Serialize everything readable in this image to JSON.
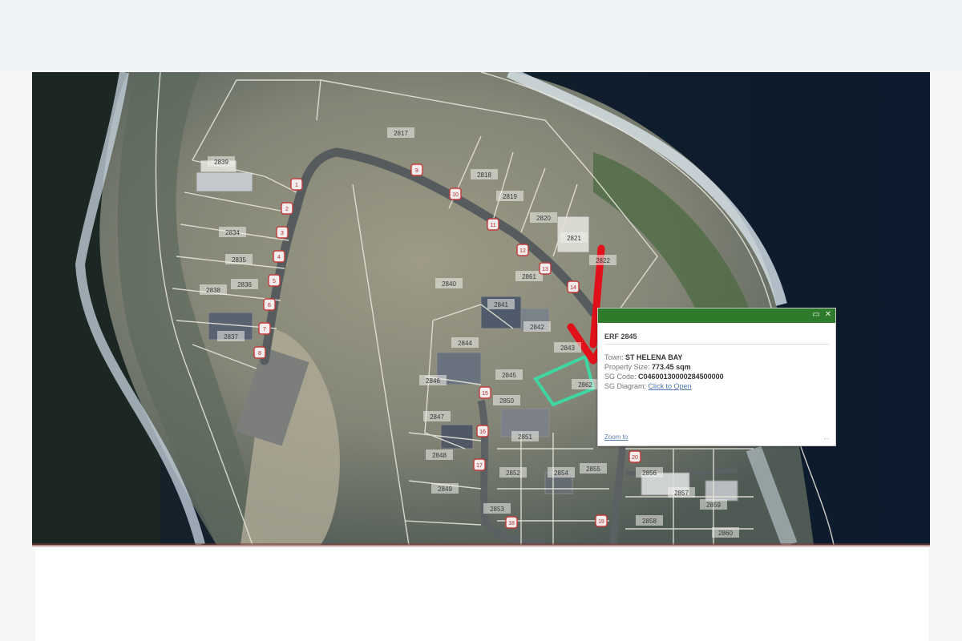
{
  "map": {
    "parcels": [
      "2817",
      "2818",
      "2819",
      "2820",
      "2821",
      "2822",
      "2834",
      "2835",
      "2836",
      "2837",
      "2838",
      "2839",
      "2840",
      "2841",
      "2842",
      "2843",
      "2844",
      "2845",
      "2846",
      "2847",
      "2848",
      "2849",
      "2850",
      "2851",
      "2852",
      "2853",
      "2854",
      "2855",
      "2856",
      "2857",
      "2858",
      "2859",
      "2860",
      "2861",
      "2862"
    ],
    "house_numbers": [
      "1",
      "2",
      "3",
      "4",
      "5",
      "6",
      "7",
      "8",
      "9",
      "10",
      "11",
      "12",
      "13",
      "14",
      "15",
      "16",
      "17",
      "18",
      "19",
      "20"
    ]
  },
  "popup": {
    "title": "ERF 2845",
    "rows": [
      {
        "key": "Town",
        "value": "ST HELENA BAY"
      },
      {
        "key": "Property Size",
        "value": "773.45 sqm"
      },
      {
        "key": "SG Code",
        "value": "C04600130000284500000"
      },
      {
        "key": "SG Diagram",
        "value": "Click to Open"
      }
    ],
    "zoom_link": "Zoom to",
    "more": "...",
    "controls": {
      "minimize": "▭",
      "close": "✕"
    }
  },
  "colors": {
    "popup_header": "#2f7b2c",
    "arrow": "#e0111b",
    "highlight": "#3fd6a4"
  }
}
